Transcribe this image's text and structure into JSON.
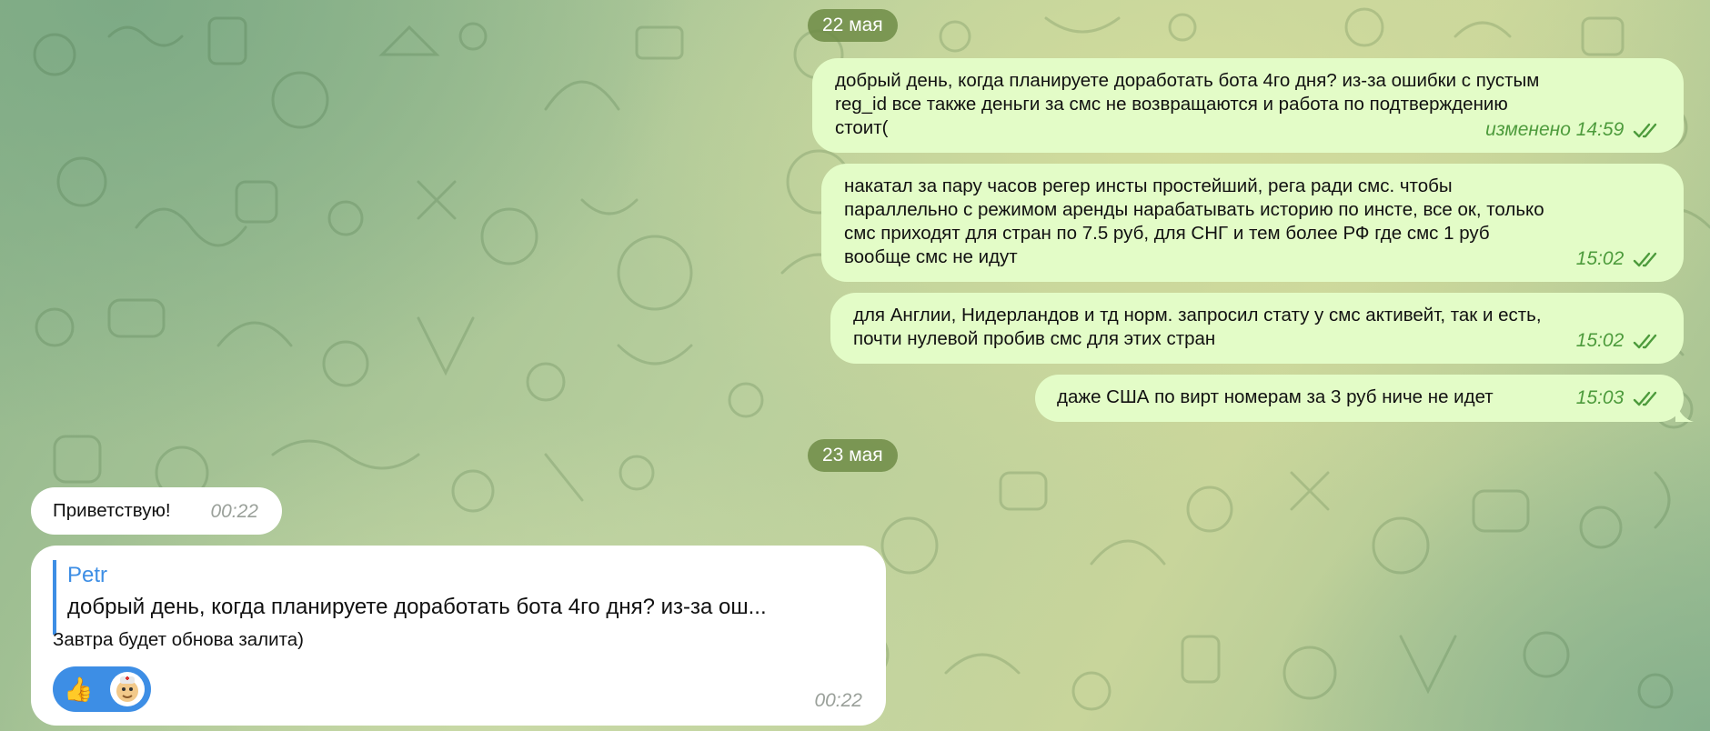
{
  "chat": {
    "date_1": "22 мая",
    "date_2": "23 мая",
    "messages_out": [
      {
        "lines": [
          "добрый день, когда планируете доработать бота 4го дня? из-за ошибки с пустым",
          "reg_id все также деньги за смс не возвращаются и работа по подтверждению",
          "стоит("
        ],
        "meta": "изменено 14:59"
      },
      {
        "lines": [
          "накатал за пару часов регер инсты простейший, рега ради смс. чтобы",
          "параллельно с режимом аренды нарабатывать историю по инсте, все ок, только",
          "смс приходят для стран по 7.5 руб, для СНГ и тем более РФ где смс 1 руб",
          "вообще смс не идут"
        ],
        "meta": "15:02"
      },
      {
        "lines": [
          "для Англии, Нидерландов и тд норм. запросил стату у смс активейт, так и есть,",
          "почти нулевой пробив смс для этих стран"
        ],
        "meta": "15:02"
      },
      {
        "lines": [
          "даже США по вирт номерам за 3 руб ниче не идет"
        ],
        "meta": "15:03"
      }
    ],
    "messages_in": [
      {
        "text": "Приветствую!",
        "meta": "00:22"
      },
      {
        "reply_name": "Petr",
        "reply_text": "добрый день, когда планируете доработать бота 4го дня? из-за ош...",
        "text": "Завтра будет обнова залита)",
        "meta": "00:22"
      }
    ],
    "reactions": [
      "👍",
      "sticker-avatar"
    ],
    "colors": {
      "outgoing_bubble": "#e3fcc7",
      "incoming_bubble": "#ffffff",
      "accent_blue": "#3d8ee5",
      "read_check": "#4d9b3c"
    }
  }
}
